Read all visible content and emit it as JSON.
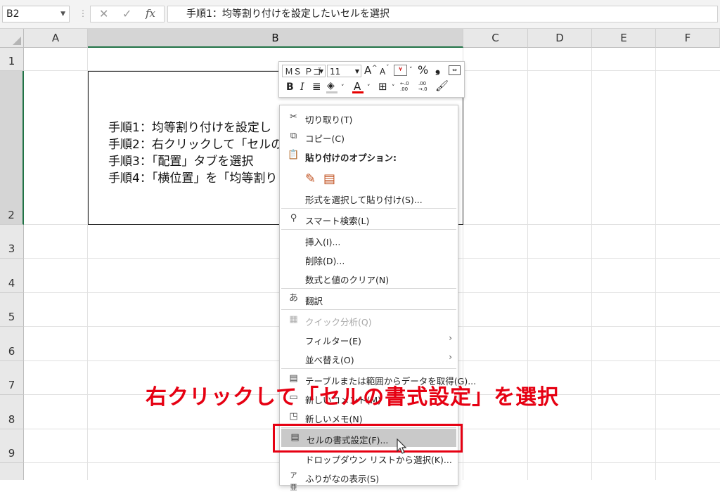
{
  "formula_bar": {
    "name_box": "B2",
    "cancel_symbol": "✕",
    "enter_symbol": "✓",
    "fx_label": "fx",
    "content": "手順1：均等割り付けを設定したいセルを選択"
  },
  "columns": [
    "A",
    "B",
    "C",
    "D",
    "E",
    "F"
  ],
  "rows": [
    "1",
    "2",
    "3",
    "4",
    "5",
    "6",
    "7",
    "8",
    "9"
  ],
  "cell_b2": {
    "lines": [
      "手順1：均等割り付けを設定し",
      "手順2：右クリックして「セルの",
      "手順3：「配置」タブを選択",
      "手順4：「横位置」を「均等割り"
    ]
  },
  "mini_toolbar": {
    "font_name": "ＭＳ Ｐゴ",
    "font_size": "11",
    "grow_font": "A",
    "shrink_font": "A",
    "percent": "%",
    "comma": "❟",
    "bold": "B",
    "italic": "I",
    "font_color_letter": "A",
    "decimal_increase": "←.0 .00",
    "decimal_decrease": ".00 →.0"
  },
  "context_menu": {
    "items": [
      {
        "label": "切り取り(T)",
        "icon": "scissors-icon"
      },
      {
        "label": "コピー(C)",
        "icon": "copy-icon"
      },
      {
        "label": "貼り付けのオプション:",
        "icon": "paste-icon"
      },
      {
        "label": "形式を選択して貼り付け(S)...",
        "icon": ""
      },
      {
        "label": "スマート検索(L)",
        "icon": "smart-lookup-icon"
      },
      {
        "label": "挿入(I)...",
        "icon": ""
      },
      {
        "label": "削除(D)...",
        "icon": ""
      },
      {
        "label": "数式と値のクリア(N)",
        "icon": ""
      },
      {
        "label": "翻訳",
        "icon": "translate-icon"
      },
      {
        "label": "クイック分析(Q)",
        "icon": "quick-analysis-icon"
      },
      {
        "label": "フィルター(E)",
        "icon": ""
      },
      {
        "label": "並べ替え(O)",
        "icon": ""
      },
      {
        "label": "テーブルまたは範囲からデータを取得(G)...",
        "icon": "table-icon"
      },
      {
        "label": "新しいコメント(M)",
        "icon": "new-comment-icon"
      },
      {
        "label": "新しいメモ(N)",
        "icon": "new-note-icon"
      },
      {
        "label": "セルの書式設定(F)...",
        "icon": "format-cells-icon"
      },
      {
        "label": "ドロップダウン リストから選択(K)...",
        "icon": ""
      },
      {
        "label": "ふりがなの表示(S)",
        "icon": "furigana-icon"
      }
    ],
    "submenu_arrow": "›"
  },
  "annotation": {
    "text": "右クリックして「セルの書式設定」を選択",
    "color": "#e60012"
  }
}
